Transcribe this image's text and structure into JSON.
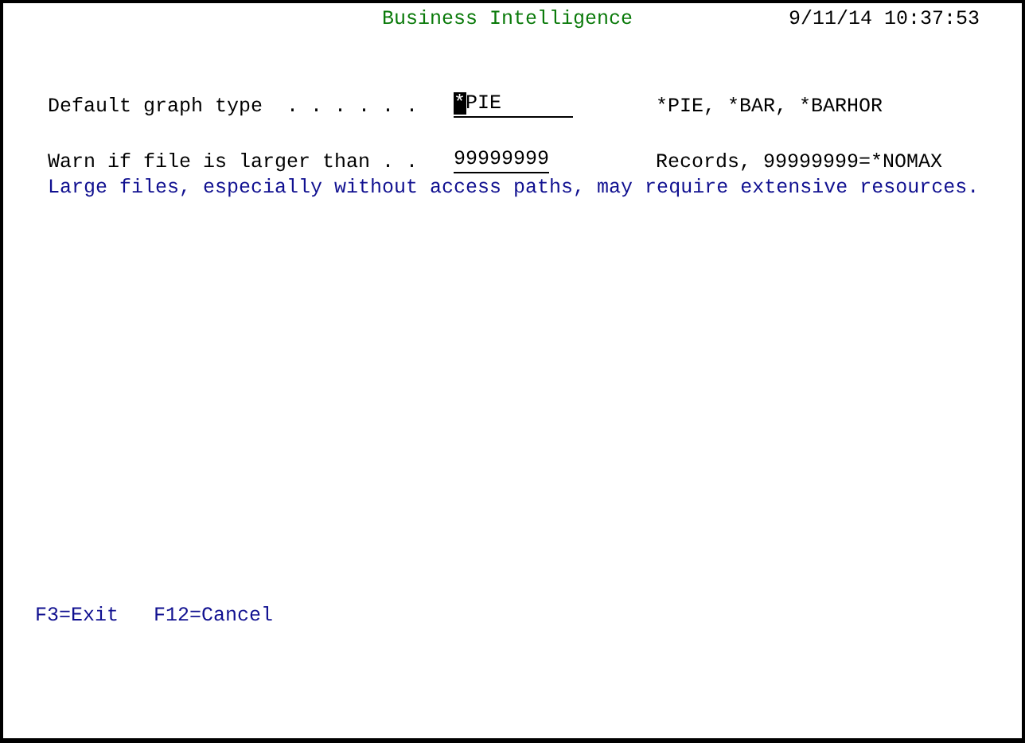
{
  "header": {
    "title": "Business Intelligence",
    "datetime": "9/11/14 10:37:53"
  },
  "fields": [
    {
      "label": "Default graph type  . . . . . .",
      "value": "*PIE",
      "cursor": true,
      "hint": "*PIE, *BAR, *BARHOR"
    },
    {
      "label": "Warn if file is larger than . .",
      "value": "99999999",
      "cursor": false,
      "hint": "Records, 99999999=*NOMAX"
    }
  ],
  "message": "Large files, especially without access paths, may require extensive resources.",
  "function_keys": [
    "F3=Exit",
    "F12=Cancel"
  ]
}
